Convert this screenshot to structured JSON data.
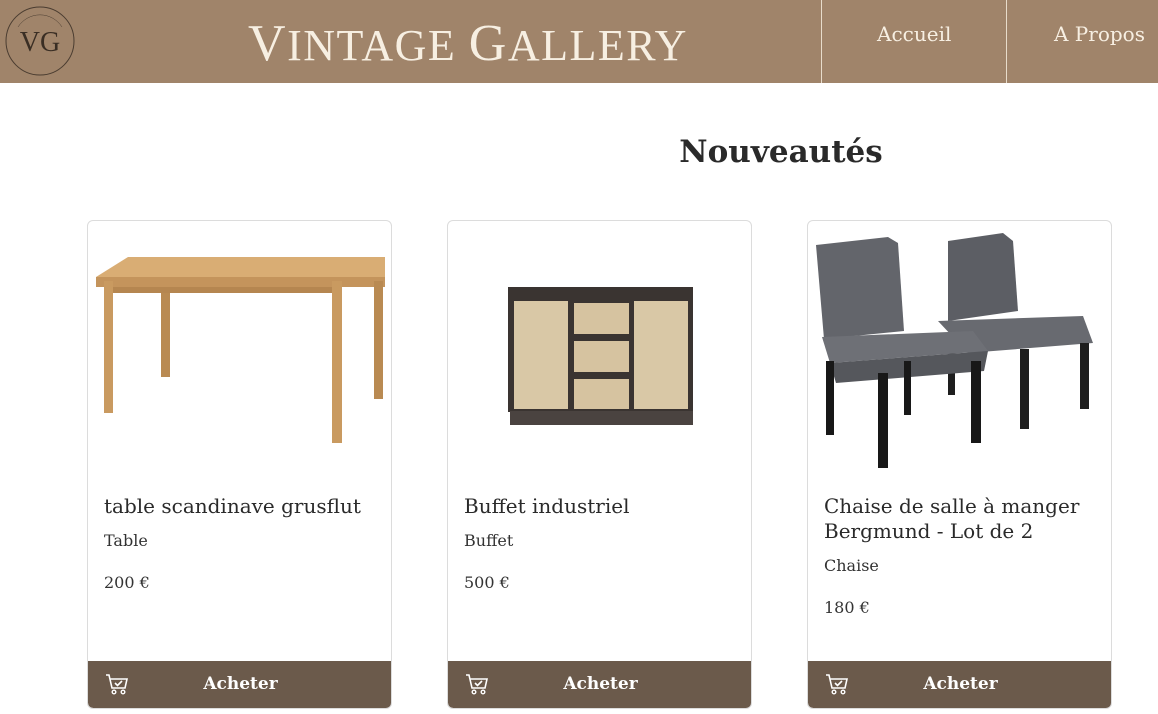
{
  "header": {
    "logo_text": "VG",
    "logo_ring_text": "VINTAGE GALLERY",
    "brand_first": "V",
    "brand_rest_1": "INTAGE ",
    "brand_second": "G",
    "brand_rest_2": "ALLERY",
    "nav": [
      {
        "label": "Accueil"
      },
      {
        "label": "A Propos"
      }
    ],
    "background_color": "#a0846a"
  },
  "main": {
    "section_title": "Nouveautés",
    "products": [
      {
        "name": "table scandinave grusflut",
        "category": "Table",
        "price": "200 €",
        "buy_label": "Acheter",
        "image": "wooden-table"
      },
      {
        "name": "Buffet industriel",
        "category": "Buffet",
        "price": "500 €",
        "buy_label": "Acheter",
        "image": "industrial-buffet"
      },
      {
        "name": "Chaise de salle à manger Bergmund - Lot de 2",
        "category": "Chaise",
        "price": "180 €",
        "buy_label": "Acheter",
        "image": "grey-dining-chairs"
      }
    ],
    "button_color": "#6b5a4b"
  }
}
